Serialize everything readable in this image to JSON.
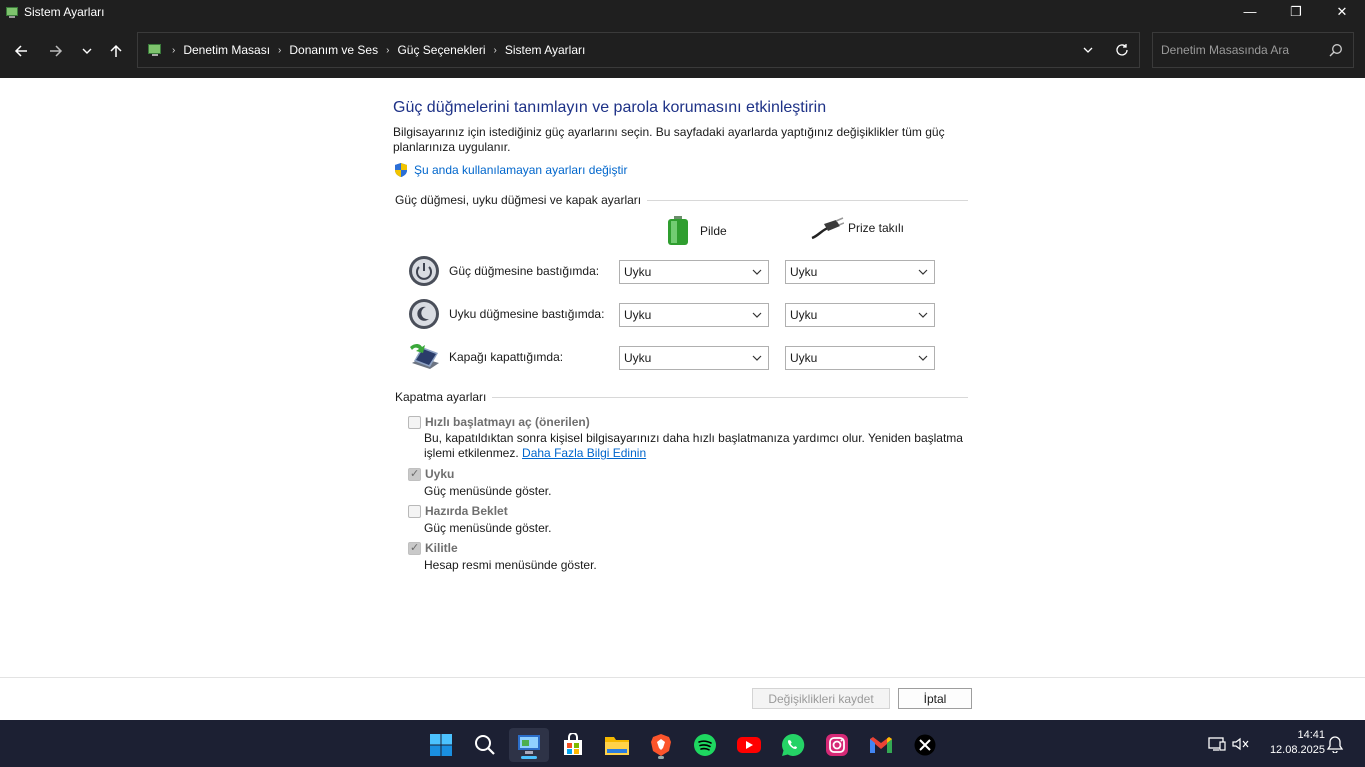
{
  "window": {
    "title": "Sistem Ayarları",
    "controls": {
      "minimize": "—",
      "restore": "❐",
      "close": "✕"
    }
  },
  "nav": {
    "breadcrumb": [
      "Denetim Masası",
      "Donanım ve Ses",
      "Güç Seçenekleri",
      "Sistem Ayarları"
    ],
    "search_placeholder": "Denetim Masasında Ara"
  },
  "main": {
    "title": "Güç düğmelerini tanımlayın ve parola korumasını etkinleştirin",
    "description": "Bilgisayarınız için istediğiniz güç ayarlarını seçin. Bu sayfadaki ayarlarda yaptığınız değişiklikler tüm güç planlarınıza uygulanır.",
    "admin_link": "Şu anda kullanılamayan ayarları değiştir",
    "section_buttons": "Güç düğmesi, uyku düğmesi ve kapak ayarları",
    "col_battery": "Pilde",
    "col_plugged": "Prize takılı",
    "rows": [
      {
        "label": "Güç düğmesine bastığımda:",
        "battery": "Uyku",
        "plugged": "Uyku",
        "icon": "power-button-icon"
      },
      {
        "label": "Uyku düğmesine bastığımda:",
        "battery": "Uyku",
        "plugged": "Uyku",
        "icon": "sleep-button-icon"
      },
      {
        "label": "Kapağı kapattığımda:",
        "battery": "Uyku",
        "plugged": "Uyku",
        "icon": "laptop-lid-icon"
      }
    ],
    "section_shutdown": "Kapatma ayarları",
    "shutdown": [
      {
        "label": "Hızlı başlatmayı aç (önerilen)",
        "checked": false,
        "desc": "Bu, kapatıldıktan sonra kişisel bilgisayarınızı daha hızlı başlatmanıza yardımcı olur. Yeniden başlatma işlemi etkilenmez.",
        "link": "Daha Fazla Bilgi Edinin"
      },
      {
        "label": "Uyku",
        "checked": true,
        "desc": "Güç menüsünde göster."
      },
      {
        "label": "Hazırda Beklet",
        "checked": false,
        "desc": "Güç menüsünde göster."
      },
      {
        "label": "Kilitle",
        "checked": true,
        "desc": "Hesap resmi menüsünde göster."
      }
    ]
  },
  "footer": {
    "save": "Değişiklikleri kaydet",
    "cancel": "İptal"
  },
  "taskbar": {
    "time": "14:41",
    "date": "12.08.2025",
    "apps": [
      "windows-start-icon",
      "search-icon",
      "control-panel-icon",
      "microsoft-store-icon",
      "file-explorer-icon",
      "brave-icon",
      "spotify-icon",
      "youtube-icon",
      "whatsapp-icon",
      "instagram-icon",
      "gmail-icon",
      "x-icon"
    ]
  }
}
